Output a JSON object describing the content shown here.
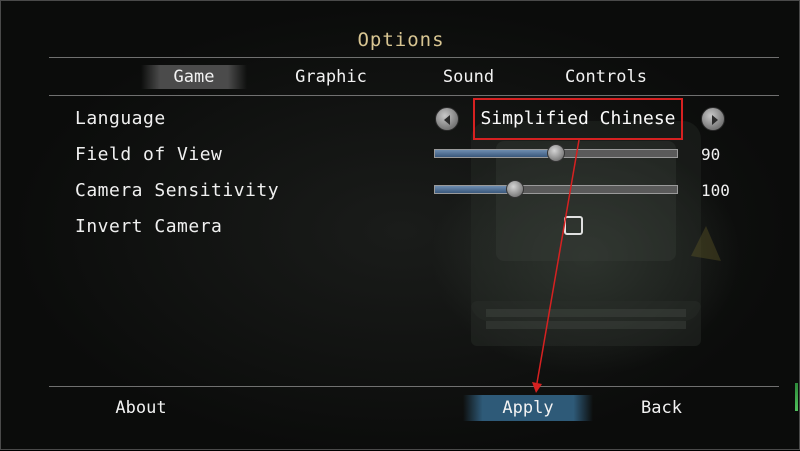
{
  "title": "Options",
  "tabs": [
    {
      "label": "Game",
      "active": true
    },
    {
      "label": "Graphic",
      "active": false
    },
    {
      "label": "Sound",
      "active": false
    },
    {
      "label": "Controls",
      "active": false
    }
  ],
  "settings": {
    "language": {
      "label": "Language",
      "value": "Simplified Chinese",
      "prev_icon": "chevron-left-icon",
      "next_icon": "chevron-right-icon"
    },
    "field_of_view": {
      "label": "Field of View",
      "value": "90",
      "fraction": 0.5
    },
    "camera_sensitivity": {
      "label": "Camera Sensitivity",
      "value": "100",
      "fraction": 0.33
    },
    "invert_camera": {
      "label": "Invert Camera",
      "checked": false
    }
  },
  "buttons": {
    "about": "About",
    "apply": "Apply",
    "back": "Back"
  },
  "colors": {
    "title": "#d8c592",
    "highlight_box": "#d62121",
    "annotation_arrow": "#d62121",
    "apply_active": "#2e5a78",
    "slider_fill": "#4a6d94"
  }
}
